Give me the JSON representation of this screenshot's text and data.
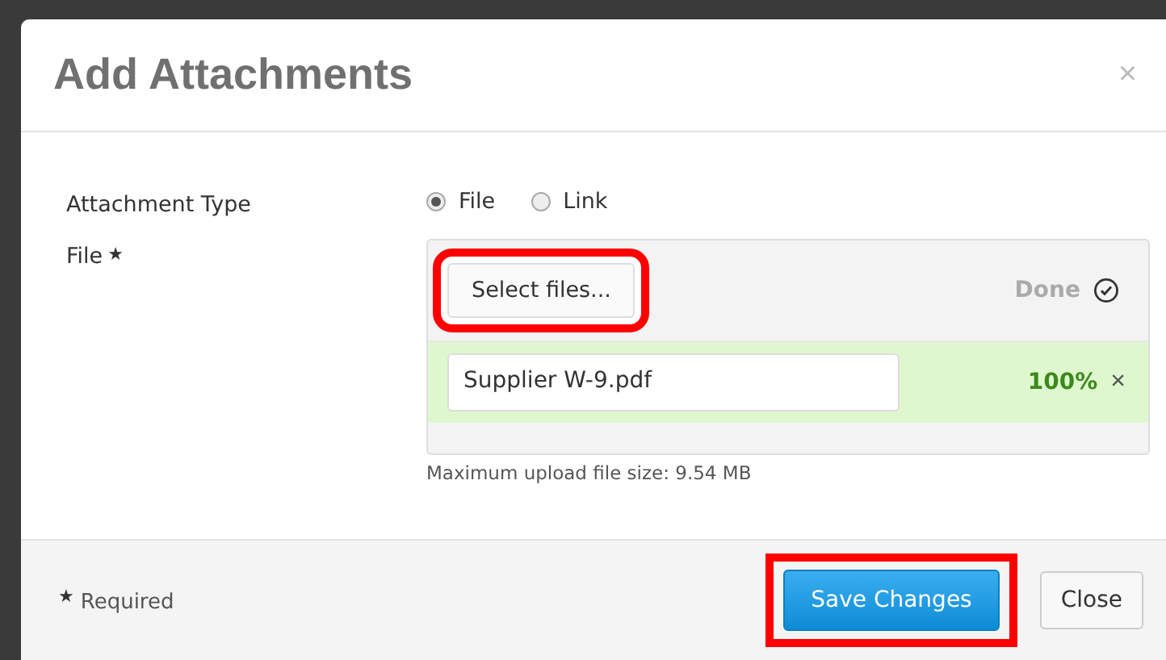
{
  "dialog": {
    "title": "Add Attachments",
    "close": "×"
  },
  "attachment_type": {
    "label": "Attachment Type",
    "options": [
      {
        "label": "File",
        "selected": true
      },
      {
        "label": "Link",
        "selected": false
      }
    ]
  },
  "file": {
    "label": "File",
    "required_mark": "★",
    "select_button": {
      "label": "Select files...",
      "highlighted": true
    },
    "status": "Done",
    "uploads": [
      {
        "name": "Supplier W-9.pdf",
        "percent": "100%",
        "remove": "×",
        "level": 1
      }
    ],
    "hint": "Maximum upload file size: 9.54 MB"
  },
  "footer": {
    "required_mark": "★",
    "required_text": "Required",
    "buttons": [
      {
        "label": "Save Changes",
        "kind": "primary",
        "highlighted": true
      },
      {
        "label": "Close",
        "kind": "default",
        "highlighted": false
      }
    ]
  }
}
